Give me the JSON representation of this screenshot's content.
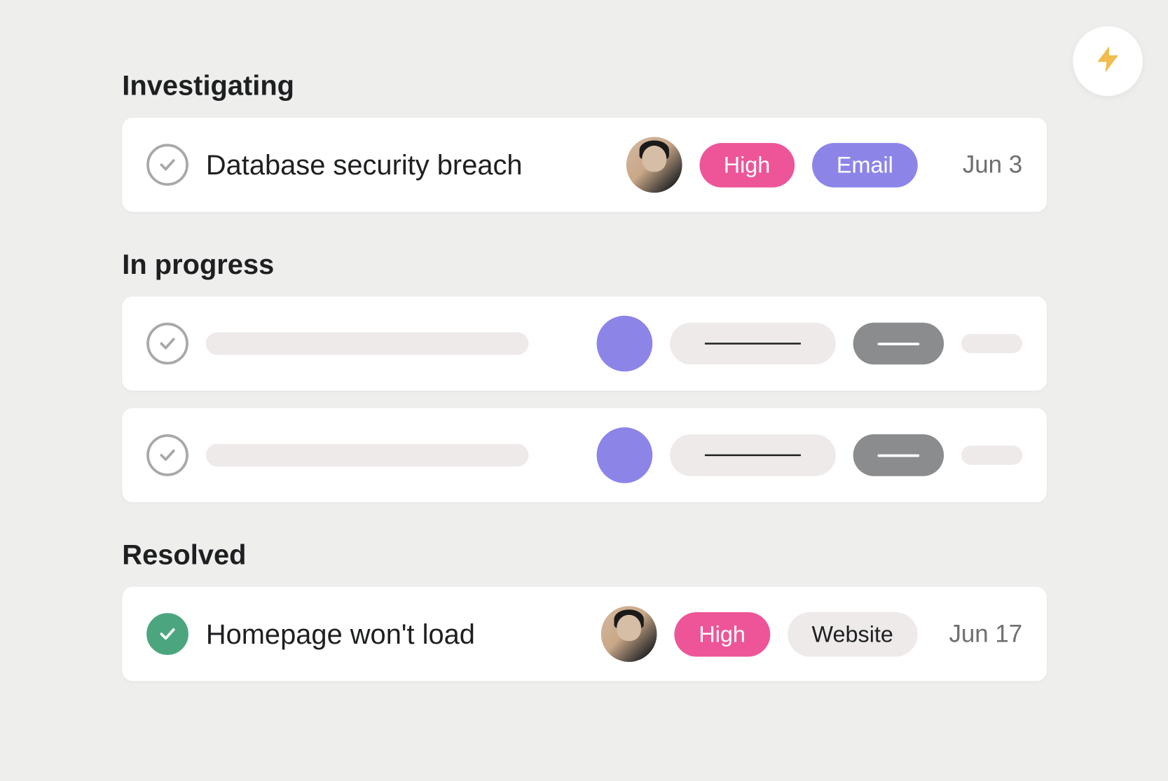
{
  "colors": {
    "priority_high": "#ed5598",
    "source_email": "#8d84e8",
    "source_website": "#edeae9",
    "avatar_placeholder": "#8d84e8",
    "completed_check": "#4ba67f",
    "lightning": "#f1bd4f"
  },
  "actionButton": {
    "icon": "lightning-icon"
  },
  "sections": [
    {
      "key": "investigating",
      "title": "Investigating",
      "tasks": [
        {
          "type": "task",
          "completed": false,
          "title": "Database security breach",
          "assignee": "avatar",
          "priority": {
            "label": "High",
            "colorKey": "priority_high"
          },
          "source": {
            "label": "Email",
            "colorKey": "source_email",
            "textLight": true
          },
          "date": "Jun 3"
        }
      ]
    },
    {
      "key": "in_progress",
      "title": "In progress",
      "tasks": [
        {
          "type": "placeholder",
          "avatarColorKey": "avatar_placeholder"
        },
        {
          "type": "placeholder",
          "avatarColorKey": "avatar_placeholder"
        }
      ]
    },
    {
      "key": "resolved",
      "title": "Resolved",
      "tasks": [
        {
          "type": "task",
          "completed": true,
          "title": "Homepage won't load",
          "assignee": "avatar",
          "priority": {
            "label": "High",
            "colorKey": "priority_high"
          },
          "source": {
            "label": "Website",
            "colorKey": "source_website",
            "textLight": false
          },
          "date": "Jun 17"
        }
      ]
    }
  ]
}
